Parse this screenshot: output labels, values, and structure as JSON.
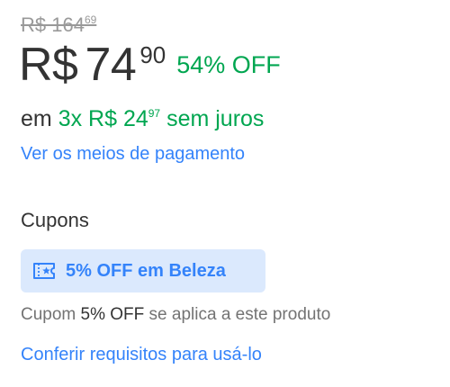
{
  "price": {
    "old_integer": "R$ 164",
    "old_cents": "69",
    "currency": "R$",
    "integer": "74",
    "cents": "90",
    "discount": "54% OFF"
  },
  "installments": {
    "prefix": "em",
    "count_price": "3x R$ 24",
    "cents": "97",
    "suffix": "sem juros"
  },
  "payment_link": "Ver os meios de pagamento",
  "coupons": {
    "title": "Cupons",
    "badge_label": "5% OFF em Beleza",
    "badge_icon": "coupon-ticket-icon",
    "desc_prefix": "Cupom",
    "desc_strong": "5% OFF",
    "desc_suffix": "se aplica a este produto",
    "requirements_link": "Conferir requisitos para usá-lo"
  },
  "colors": {
    "green": "#00a650",
    "link_blue": "#3483fa",
    "badge_bg": "#dbe9fd",
    "text": "#333333",
    "muted": "#999999"
  }
}
